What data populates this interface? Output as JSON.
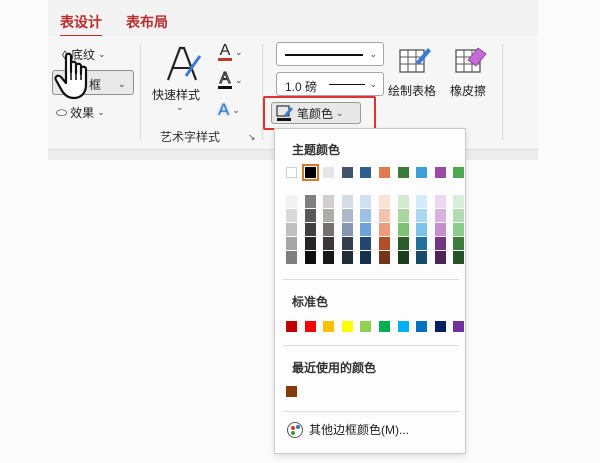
{
  "tabs": [
    {
      "label": "表设计",
      "active": true
    },
    {
      "label": "表布局",
      "active": false
    }
  ],
  "table_styles_group": {
    "shading_label": "底纹",
    "borders_label": "框",
    "effects_label": "效果"
  },
  "wordart_group": {
    "quick_styles_label": "快速样式",
    "group_label": "艺术字样式",
    "text_fill_glyph": "A",
    "text_outline_glyph": "A",
    "text_effects_glyph": "A",
    "fill_color": "#c0392b",
    "effects_color": "#2e75c6"
  },
  "draw_borders_group": {
    "weight_value": "1.0 磅",
    "pen_color_label": "笔颜色",
    "draw_table_label": "绘制表格",
    "eraser_label": "橡皮擦"
  },
  "pen_color_dropdown": {
    "theme_colors_title": "主题颜色",
    "theme_colors_top": [
      "#ffffff",
      "#000000",
      "#e7e6e6",
      "#44546a",
      "#2e5e8e",
      "#e07a4f",
      "#3a7d3a",
      "#3f9fd6",
      "#9b4aa8",
      "#4fa84f"
    ],
    "selected_index": 1,
    "theme_shade_columns": [
      [
        "#f2f2f2",
        "#d9d9d9",
        "#bfbfbf",
        "#a6a6a6",
        "#7f7f7f"
      ],
      [
        "#7f7f7f",
        "#595959",
        "#404040",
        "#262626",
        "#0d0d0d"
      ],
      [
        "#d0cece",
        "#aeabab",
        "#757171",
        "#3a3838",
        "#171616"
      ],
      [
        "#d6dce4",
        "#adb9ca",
        "#8496b0",
        "#333f4f",
        "#222a35"
      ],
      [
        "#cfe0f2",
        "#9fc1e5",
        "#6fa2d8",
        "#234770",
        "#17304b"
      ],
      [
        "#f9e1d6",
        "#f3c3ae",
        "#ec9c7a",
        "#b04f25",
        "#753418"
      ],
      [
        "#d4ead0",
        "#a9d5a1",
        "#7ec072",
        "#2b5d2b",
        "#1d3e1d"
      ],
      [
        "#d5ebf7",
        "#aad8f0",
        "#7fc4e8",
        "#22719c",
        "#174b68"
      ],
      [
        "#ecd9ef",
        "#d9b3df",
        "#c68dcf",
        "#743680",
        "#4d2455"
      ],
      [
        "#d8eed8",
        "#b2ddb2",
        "#8bcc8b",
        "#3a7e3a",
        "#275427"
      ]
    ],
    "standard_colors_title": "标准色",
    "standard_colors": [
      "#c00000",
      "#ff0000",
      "#ffc000",
      "#ffff00",
      "#92d050",
      "#00b050",
      "#00b0f0",
      "#0070c0",
      "#002060",
      "#7030a0"
    ],
    "recent_colors_title": "最近使用的颜色",
    "recent_colors": [
      "#843c0c"
    ],
    "more_colors_label": "其他边框颜色(M)..."
  }
}
